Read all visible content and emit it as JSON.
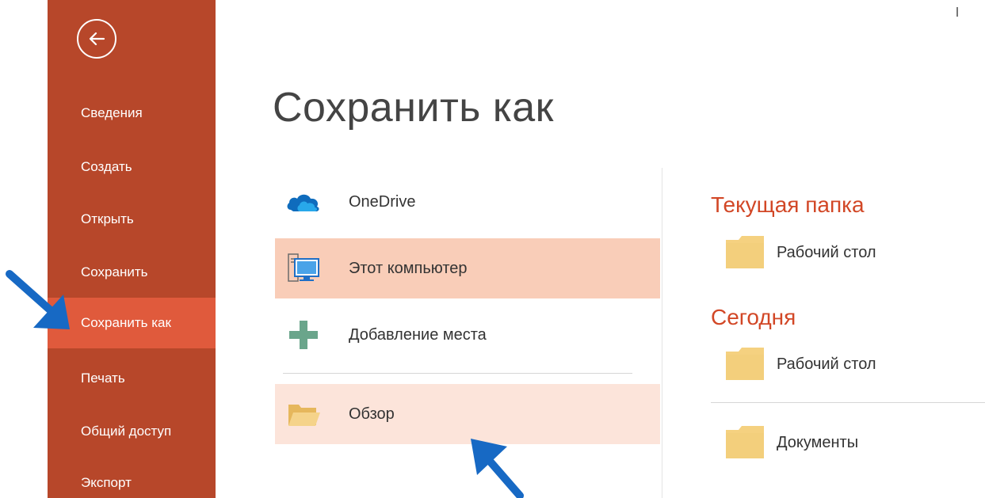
{
  "sidebar": {
    "back_label": "Назад",
    "items": [
      {
        "label": "Сведения",
        "active": false
      },
      {
        "label": "Создать",
        "active": false
      },
      {
        "label": "Открыть",
        "active": false
      },
      {
        "label": "Сохранить",
        "active": false
      },
      {
        "label": "Сохранить как",
        "active": true
      },
      {
        "label": "Печать",
        "active": false
      },
      {
        "label": "Общий доступ",
        "active": false
      },
      {
        "label": "Экспорт",
        "active": false
      }
    ]
  },
  "main": {
    "title": "Сохранить как",
    "locations": [
      {
        "label": "OneDrive",
        "icon": "onedrive-cloud-icon",
        "state": "normal"
      },
      {
        "label": "Этот компьютер",
        "icon": "computer-icon",
        "state": "selected"
      },
      {
        "label": "Добавление места",
        "icon": "plus-icon",
        "state": "normal"
      },
      {
        "label": "Обзор",
        "icon": "open-folder-icon",
        "state": "hover"
      }
    ]
  },
  "recent": {
    "sections": [
      {
        "title": "Текущая папка",
        "folders": [
          "Рабочий стол"
        ]
      },
      {
        "title": "Сегодня",
        "folders": [
          "Рабочий стол",
          "Документы"
        ]
      }
    ]
  },
  "colors": {
    "sidebar_bg": "#b7472a",
    "sidebar_active": "#e05a3c",
    "section_title": "#d24726",
    "selected_bg": "#f9cdb8",
    "hover_bg": "#fce4da",
    "folder_fill": "#f5d180",
    "annotation_arrow": "#1769c4"
  }
}
